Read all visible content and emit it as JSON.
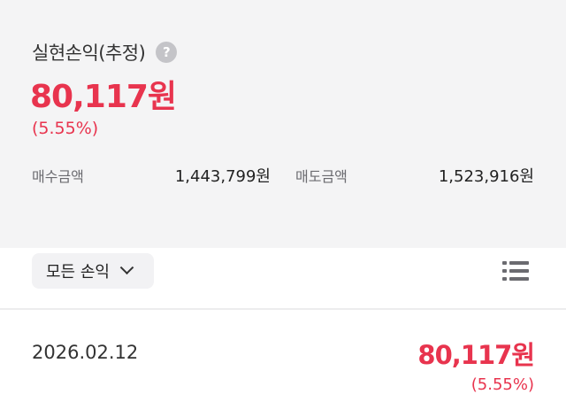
{
  "summary": {
    "title": "실현손익(추정)",
    "help_icon": "question-mark-icon",
    "pnl_amount": "80,117원",
    "pnl_rate": "(5.55%)",
    "buy_label": "매수금액",
    "buy_value": "1,443,799원",
    "sell_label": "매도금액",
    "sell_value": "1,523,916원"
  },
  "filter": {
    "label": "모든 손익",
    "icon": "chevron-down-icon"
  },
  "view_toggle_icon": "list-icon",
  "rows": [
    {
      "date": "2026.02.12",
      "amount": "80,117원",
      "rate": "(5.55%)"
    }
  ],
  "colors": {
    "profit": "#e8344e",
    "panel_bg": "#f4f4f5"
  }
}
